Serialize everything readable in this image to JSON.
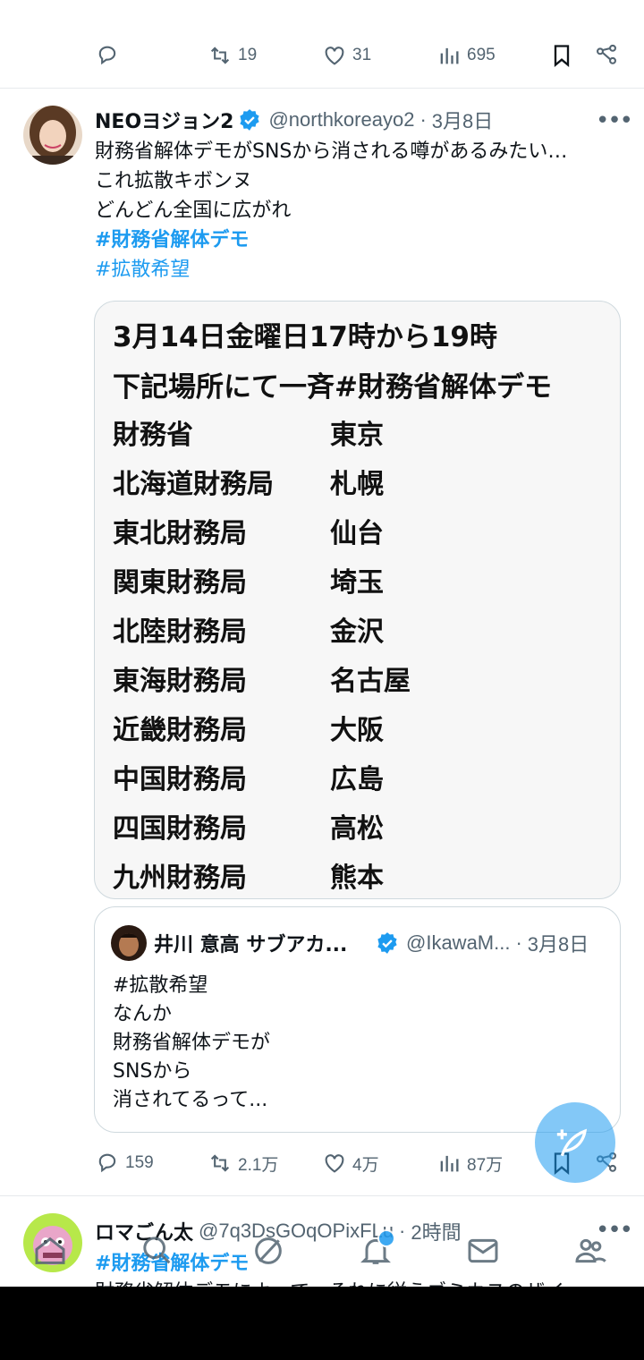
{
  "top_actions": {
    "reply_count": "",
    "retweet_count": "19",
    "like_count": "31",
    "view_count": "695"
  },
  "tweet": {
    "author_name": "NEOヨジョン2",
    "handle": "@northkoreayo2",
    "separator": "·",
    "date": "3月8日",
    "more": "•••",
    "lines": [
      "財務省解体デモがSNSから消される噂があるみたい…",
      "これ拡散キボンヌ",
      "どんどん全国に広がれ"
    ],
    "hashtag1": "#財務省解体デモ",
    "hashtag2": "#拡散希望",
    "media": {
      "heading1": "3月14日金曜日17時から19時",
      "heading2": "下記場所にて一斉#財務省解体デモ",
      "rows": [
        {
          "office": "財務省",
          "city": "東京"
        },
        {
          "office": "北海道財務局",
          "city": "札幌"
        },
        {
          "office": "東北財務局",
          "city": "仙台"
        },
        {
          "office": "関東財務局",
          "city": "埼玉"
        },
        {
          "office": "北陸財務局",
          "city": "金沢"
        },
        {
          "office": "東海財務局",
          "city": "名古屋"
        },
        {
          "office": "近畿財務局",
          "city": "大阪"
        },
        {
          "office": "中国財務局",
          "city": "広島"
        },
        {
          "office": "四国財務局",
          "city": "高松"
        },
        {
          "office": "九州財務局",
          "city": "熊本"
        }
      ]
    },
    "quote": {
      "author_name": "井川 意高 サブアカ...",
      "handle": "@IkawaM...",
      "separator": "·",
      "date": "3月8日",
      "lines": [
        "#拡散希望",
        "なんか",
        "財務省解体デモが",
        "SNSから",
        "消されてるって..."
      ]
    },
    "actions": {
      "reply_count": "159",
      "retweet_count": "2.1万",
      "like_count": "4万",
      "view_count": "87万"
    }
  },
  "tweet2": {
    "author_name": "ロマごん太",
    "handle": "@7q3DsGOqOPixFLu",
    "separator": "·",
    "time": "2時間",
    "more": "•••",
    "hashtag": "#財務省解体デモ",
    "text_partial": "財務省解体デモによって、それに従うゴミカスのザイ"
  },
  "nav": {
    "icons": [
      "home-icon",
      "search-icon",
      "grok-icon",
      "notifications-icon",
      "messages-icon",
      "communities-icon"
    ]
  },
  "colors": {
    "accent": "#1d9bf0",
    "muted": "#536471",
    "text": "#0f1419",
    "border": "#cfd9de"
  }
}
